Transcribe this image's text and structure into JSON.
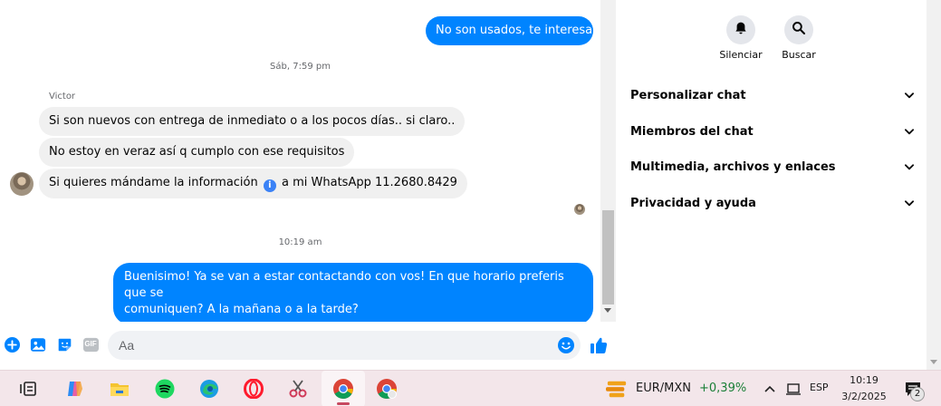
{
  "chat": {
    "messages_top": [
      {
        "text": "No son usados, te interesa?",
        "direction": "outgoing"
      }
    ],
    "timestamp_1": "Sáb, 7:59 pm",
    "sender_name": "Victor",
    "incoming": [
      "Si son nuevos con entrega de inmediato o a los pocos días..  si claro..",
      "No estoy en veraz así q cumplo con ese requisitos"
    ],
    "incoming_last": {
      "before": "Si quieres mándame la información",
      "after": "a mi WhatsApp 11.2680.8429"
    },
    "timestamp_2": "10:19 am",
    "outgoing_last": [
      "Buenisimo! Ya se van a estar contactando con vos! En que horario preferis que se",
      "comuniquen? A la mañana o a la tarde?"
    ]
  },
  "composer": {
    "placeholder": "Aa",
    "icons": [
      "plus-icon",
      "image-icon",
      "sticker-icon",
      "gif-icon",
      "emoji-icon",
      "like-icon"
    ],
    "gif_label": "GIF"
  },
  "panel": {
    "actions": [
      {
        "label": "Silenciar",
        "icon": "bell-icon"
      },
      {
        "label": "Buscar",
        "icon": "search-icon"
      }
    ],
    "sections": [
      "Personalizar chat",
      "Miembros del chat",
      "Multimedia, archivos y enlaces",
      "Privacidad y ayuda"
    ]
  },
  "taskbar": {
    "apps": [
      "task-view-icon",
      "copilot-icon",
      "file-explorer-icon",
      "spotify-icon",
      "edge-icon",
      "opera-icon",
      "snipping-tool-icon",
      "chrome-icon",
      "chrome-alt-icon"
    ],
    "ticker": {
      "pair": "EUR/MXN",
      "change": "+0,39%"
    },
    "language": "ESP",
    "time": "10:19",
    "date": "3/2/2025",
    "notifications": "2"
  },
  "colors": {
    "accent": "#0084ff",
    "incoming_bubble": "#f0f0f0",
    "taskbar": "#f3e6ea",
    "ticker_positive": "#1a7f37"
  }
}
